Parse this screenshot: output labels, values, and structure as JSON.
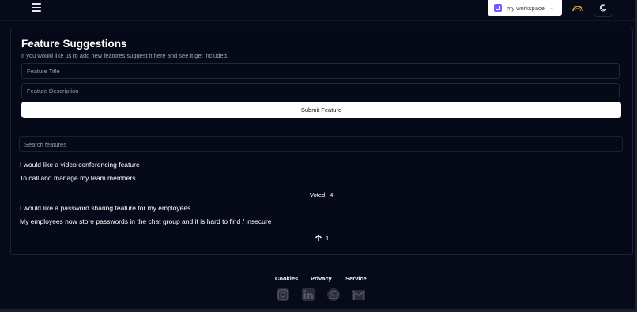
{
  "header": {
    "workspace_label": "my workspace",
    "icons": [
      "menu-icon",
      "workspace-logo-icon",
      "chevron-down-icon",
      "gauge-icon",
      "moon-icon"
    ]
  },
  "form": {
    "title": "Feature Suggestions",
    "subtitle": "If you would like us to add new features suggest it here and see it get included.",
    "title_placeholder": "Feature Title",
    "description_placeholder": "Feature Description",
    "submit_label": "Submit Feature"
  },
  "search": {
    "placeholder": "Search features"
  },
  "features": [
    {
      "title": "I would like a video conferencing feature",
      "description": "To call and manage my team members",
      "vote_label": "Voted",
      "votes": "4"
    },
    {
      "title": "I would like a password sharing feature for my employees",
      "description": "My employees now store passwords in the chat group and it is hard to find / insecure",
      "votes": "1"
    }
  ],
  "footer": {
    "links": [
      "Cookies",
      "Privacy",
      "Service"
    ],
    "social_icons": [
      "instagram-icon",
      "linkedin-icon",
      "whatsapp-icon",
      "mail-icon"
    ]
  },
  "colors": {
    "background": "#070a18",
    "border": "#1e2233",
    "accent": "#6d5df5"
  }
}
